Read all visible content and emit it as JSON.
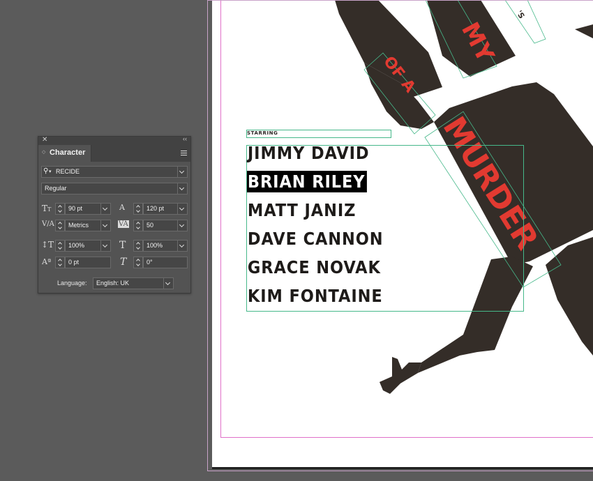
{
  "character_panel": {
    "title": "Character",
    "font_family": "RECIDE",
    "font_style": "Regular",
    "font_size": "90 pt",
    "leading": "120 pt",
    "kerning": "Metrics",
    "tracking": "50",
    "vertical_scale": "100%",
    "horizontal_scale": "100%",
    "baseline_shift": "0 pt",
    "skew": "0°",
    "language_label": "Language:",
    "language_value": "English: UK"
  },
  "document": {
    "starring_label": "STARRING",
    "cast": [
      "JIMMY DAVID",
      "BRIAN RILEY",
      "MATT JANIZ",
      "DAVE CANNON",
      "GRACE NOVAK",
      "KIM FONTAINE"
    ],
    "selected_cast_index": 1,
    "artwork_text": [
      "'S",
      "MY",
      "OF A",
      "MURDER"
    ],
    "colors": {
      "silhouette": "#342d28",
      "title_red": "#e23a31",
      "frame_guide": "#46b88a",
      "margin_guide": "#e070c8",
      "pasteboard": "#5b5b5b",
      "panel_bg": "#535353"
    }
  }
}
